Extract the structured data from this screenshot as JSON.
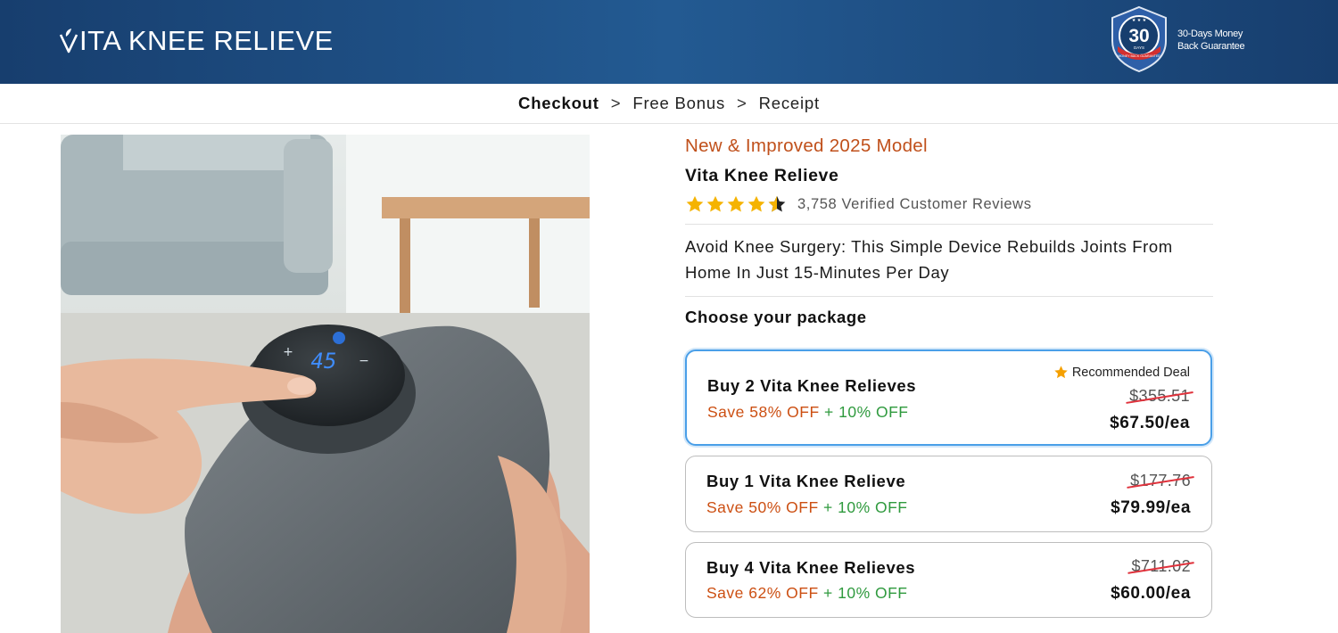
{
  "header": {
    "logo_text": "ITA KNEE RELIEVE",
    "badge": {
      "number": "30",
      "top_text": "DAYS",
      "ribbon_text": "MONEY BACK GUARANTEE"
    },
    "guarantee_line1": "30-Days Money",
    "guarantee_line2": "Back Guarantee"
  },
  "breadcrumb": {
    "items": [
      "Checkout",
      "Free Bonus",
      "Receipt"
    ],
    "separator": ">",
    "active_index": 0
  },
  "product_image": {
    "icon": "knee-device-photo",
    "display_value": "45",
    "plus": "+",
    "minus": "−"
  },
  "product": {
    "model": "New & Improved 2025 Model",
    "name": "Vita Knee Relieve",
    "rating": 4.5,
    "reviews": "3,758 Verified Customer Reviews",
    "headline_line1": "Avoid Knee Surgery: This Simple Device Rebuilds Joints From",
    "headline_line2": "Home In Just 15-Minutes Per Day",
    "choose_label": "Choose your package"
  },
  "packages": [
    {
      "title": "Buy 2 Vita Knee Relieves",
      "save_primary": "Save 58% OFF",
      "save_plus": "+ 10% OFF",
      "old_price": "$355.51",
      "price": "$67.50/ea",
      "recommended": "Recommended Deal",
      "selected": true
    },
    {
      "title": "Buy 1 Vita Knee Relieve",
      "save_primary": "Save 50% OFF",
      "save_plus": "+ 10% OFF",
      "old_price": "$177.76",
      "price": "$79.99/ea",
      "selected": false
    },
    {
      "title": "Buy 4 Vita Knee Relieves",
      "save_primary": "Save 62% OFF",
      "save_plus": "+ 10% OFF",
      "old_price": "$711.02",
      "price": "$60.00/ea",
      "selected": false
    }
  ],
  "colors": {
    "header": "#1e4d84",
    "model_text": "#c0501b",
    "save_orange": "#cc4f12",
    "save_green": "#2f9a3e",
    "selected_border": "#4a9fe8",
    "star": "#f5b301",
    "strike": "#e0323c"
  }
}
